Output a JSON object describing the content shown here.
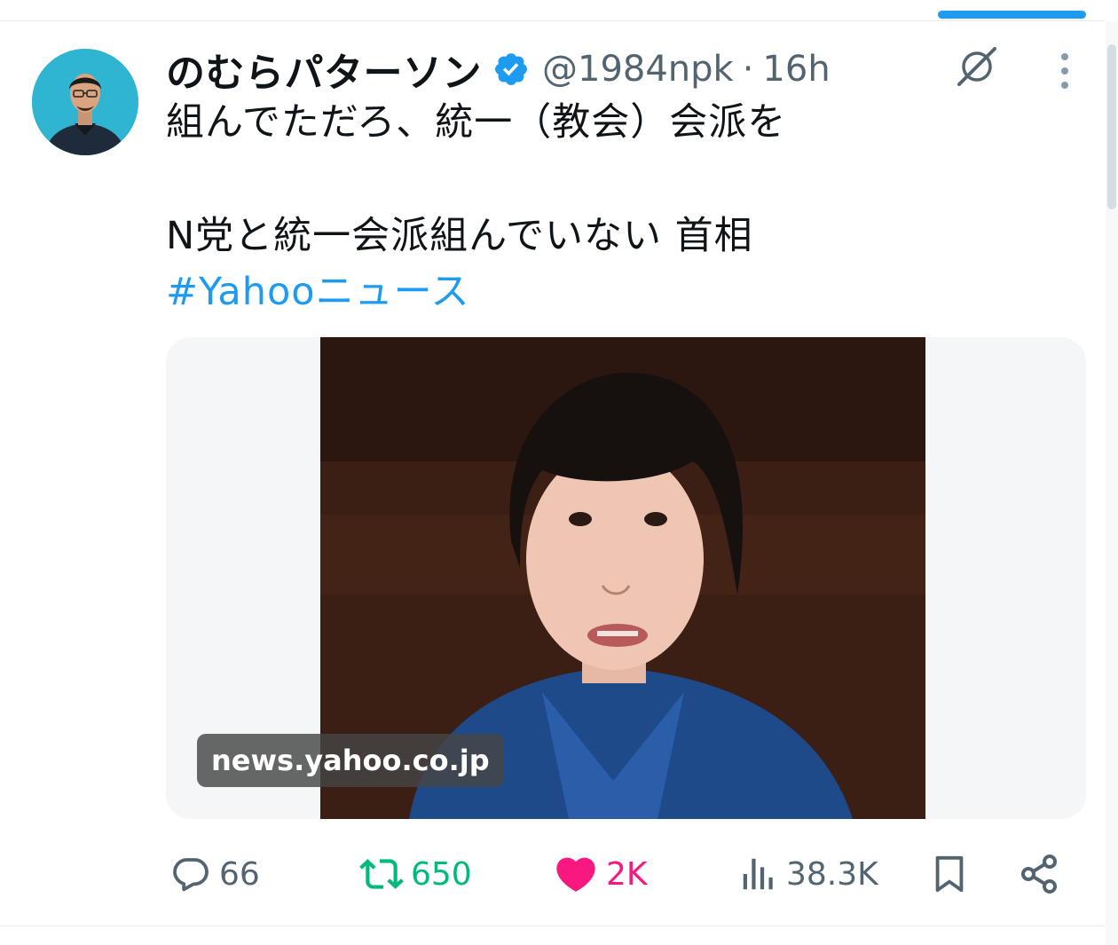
{
  "tweet": {
    "display_name": "のむらパターソン",
    "handle": "@1984npk",
    "separator": "·",
    "time_ago": "16h",
    "body_line_1": "組んでただろ、統一（教会）会派を",
    "body_line_2": "N党と統一会派組んでいない 首相",
    "hashtag": "#Yahooニュース"
  },
  "card": {
    "domain": "news.yahoo.co.jp"
  },
  "actions": {
    "replies": "66",
    "reposts": "650",
    "likes": "2K",
    "views": "38.3K"
  },
  "icons": {
    "verified": "verified-badge-icon",
    "grok": "grok-icon",
    "more": "more-options-icon",
    "reply": "reply-icon",
    "repost": "repost-icon",
    "like": "heart-icon",
    "views": "views-bar-chart-icon",
    "bookmark": "bookmark-icon",
    "share": "share-icon"
  },
  "colors": {
    "accent": "#1d9bf0",
    "repost_active": "#00ba7c",
    "like_active": "#f91880",
    "secondary_text": "#536471"
  }
}
